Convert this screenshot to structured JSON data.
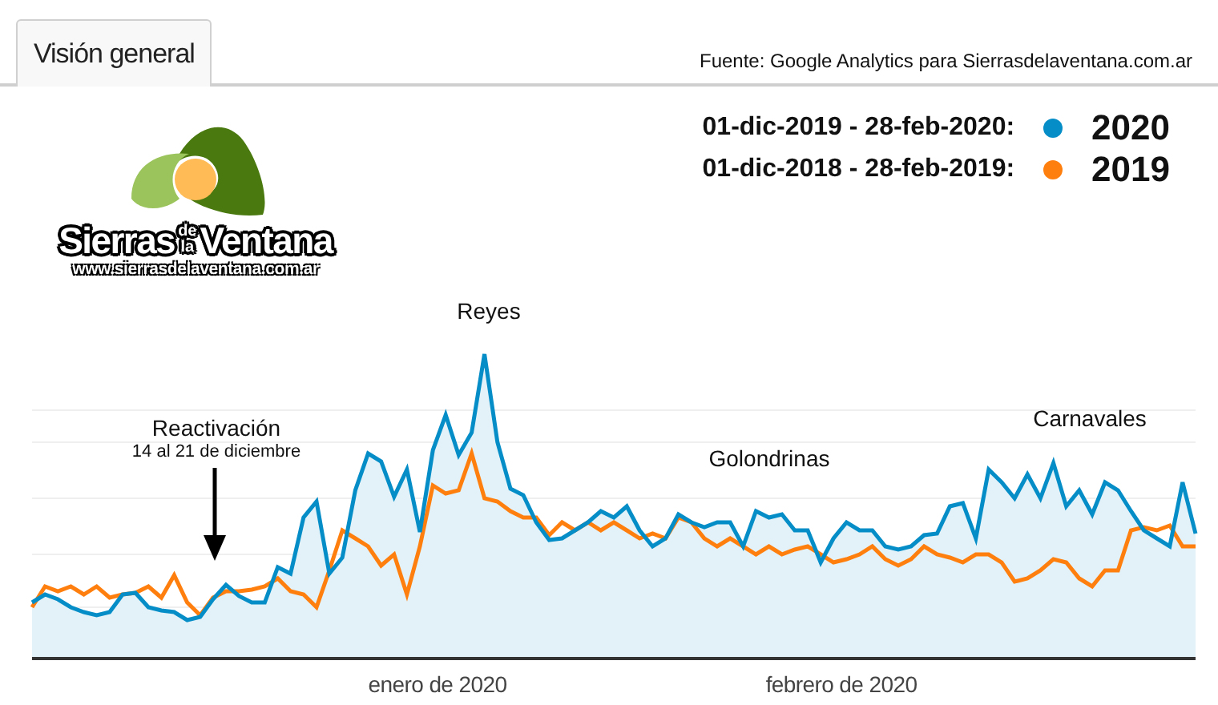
{
  "tab": {
    "label": "Visión general",
    "selected": true
  },
  "source": "Fuente: Google Analytics para Sierrasdelaventana.com.ar",
  "logo": {
    "word_1": "Sierras",
    "small_words": [
      "de",
      "la"
    ],
    "word_2": "Ventana",
    "url": "www.sierrasdelaventana.com.ar"
  },
  "legend": [
    {
      "range": "01-dic-2019 - 28-feb-2020:",
      "color": "#058dc7",
      "year": "2020"
    },
    {
      "range": "01-dic-2018 - 28-feb-2019:",
      "color": "#ff7f0e",
      "year": "2019"
    }
  ],
  "chart": {
    "x_labels": [
      "enero de 2020",
      "febrero de 2020"
    ],
    "annotations": [
      {
        "kind": "peak",
        "title": "Reyes"
      },
      {
        "kind": "event",
        "title": "Reactivación",
        "subtitle": "14 al 21 de diciembre"
      },
      {
        "kind": "peak",
        "title": "Golondrinas"
      },
      {
        "kind": "peak",
        "title": "Carnavales"
      }
    ]
  }
}
